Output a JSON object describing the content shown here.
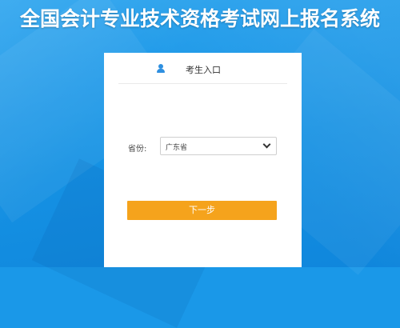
{
  "header": {
    "title": "全国会计专业技术资格考试网上报名系统"
  },
  "login": {
    "entry_title": "考生入口",
    "user_icon": "user-icon",
    "province_label": "省份:",
    "province_value": "广东省",
    "dropdown_icon": "chevron-down-icon",
    "next_button_label": "下一步"
  },
  "colors": {
    "background": "#1a98e8",
    "card": "#ffffff",
    "accent_button": "#f5a31c",
    "icon_blue": "#2e8fe0"
  }
}
